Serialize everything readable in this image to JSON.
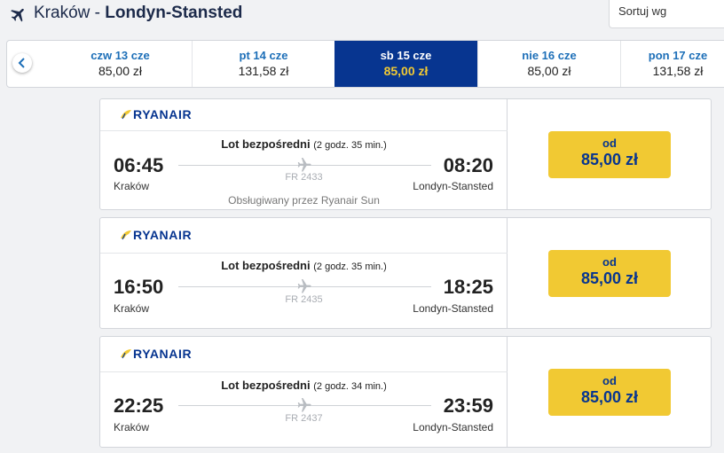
{
  "header": {
    "origin": "Kraków",
    "separator": " - ",
    "destination": "Londyn-Stansted",
    "sort_label": "Sortuj wg"
  },
  "dates": [
    {
      "label": "czw 13 cze",
      "price": "85,00 zł"
    },
    {
      "label": "pt 14 cze",
      "price": "131,58 zł"
    },
    {
      "label": "sb 15 cze",
      "price": "85,00 zł",
      "active": true
    },
    {
      "label": "nie 16 cze",
      "price": "85,00 zł"
    },
    {
      "label": "pon 17 cze",
      "price": "131,58 zł"
    }
  ],
  "flights": [
    {
      "airline": "RYANAIR",
      "direct_label": "Lot bezpośredni",
      "duration": "(2 godz. 35 min.)",
      "dep_time": "06:45",
      "arr_time": "08:20",
      "dep_city": "Kraków",
      "arr_city": "Londyn-Stansted",
      "flight_no": "FR 2433",
      "operated_by": "Obsługiwany przez Ryanair Sun",
      "price_from": "od",
      "price": "85,00 zł"
    },
    {
      "airline": "RYANAIR",
      "direct_label": "Lot bezpośredni",
      "duration": "(2 godz. 35 min.)",
      "dep_time": "16:50",
      "arr_time": "18:25",
      "dep_city": "Kraków",
      "arr_city": "Londyn-Stansted",
      "flight_no": "FR 2435",
      "price_from": "od",
      "price": "85,00 zł"
    },
    {
      "airline": "RYANAIR",
      "direct_label": "Lot bezpośredni",
      "duration": "(2 godz. 34 min.)",
      "dep_time": "22:25",
      "arr_time": "23:59",
      "dep_city": "Kraków",
      "arr_city": "Londyn-Stansted",
      "flight_no": "FR 2437",
      "price_from": "od",
      "price": "85,00 zł"
    }
  ],
  "colors": {
    "brand_blue": "#073590",
    "accent_yellow": "#f1c933",
    "link_blue": "#1d6fb8"
  }
}
